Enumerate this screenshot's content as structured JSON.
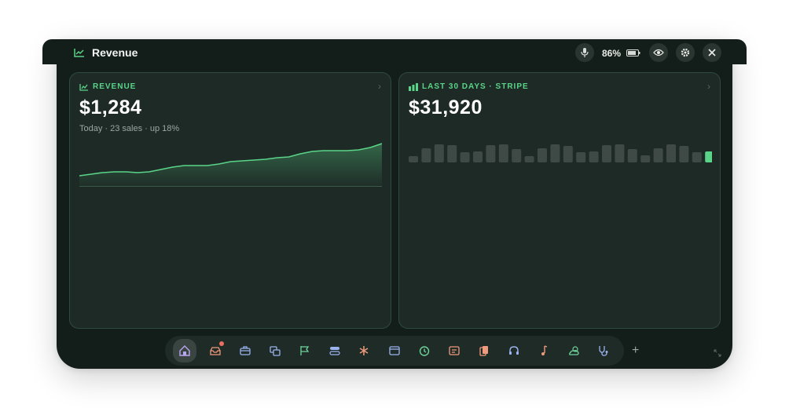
{
  "window": {
    "title": "Revenue",
    "battery_percent": "86%"
  },
  "revenue_card": {
    "label": "REVENUE",
    "value": "$1,284",
    "subtitle": "Today · 23 sales · up 18%",
    "sparkline": [
      14,
      16,
      18,
      19,
      19,
      18,
      19,
      22,
      25,
      27,
      27,
      27,
      29,
      32,
      33,
      34,
      35,
      37,
      38,
      42,
      45,
      46,
      46,
      46,
      47,
      50,
      55
    ]
  },
  "stripe_card": {
    "label": "LAST 30 DAYS · STRIPE",
    "value": "$31,920",
    "bars": [
      8,
      18,
      23,
      22,
      13,
      14,
      22,
      23,
      17,
      8,
      18,
      23,
      21,
      13,
      14,
      22,
      23,
      17,
      9,
      18,
      23,
      21,
      13,
      14
    ]
  },
  "dock": {
    "icons": [
      "home-icon",
      "inbox-tray-icon",
      "briefcase-icon",
      "windows-icon",
      "flag-icon",
      "toggles-icon",
      "asterisk-icon",
      "browser-window-icon",
      "timer-icon",
      "notes-icon",
      "cards-icon",
      "headphones-icon",
      "music-note-icon",
      "weather-icon",
      "stethoscope-icon"
    ],
    "plus": "+"
  },
  "colors": {
    "accent": "#5ad488",
    "window_bg": "#131e1a",
    "card_bg": "#1e2a26"
  }
}
